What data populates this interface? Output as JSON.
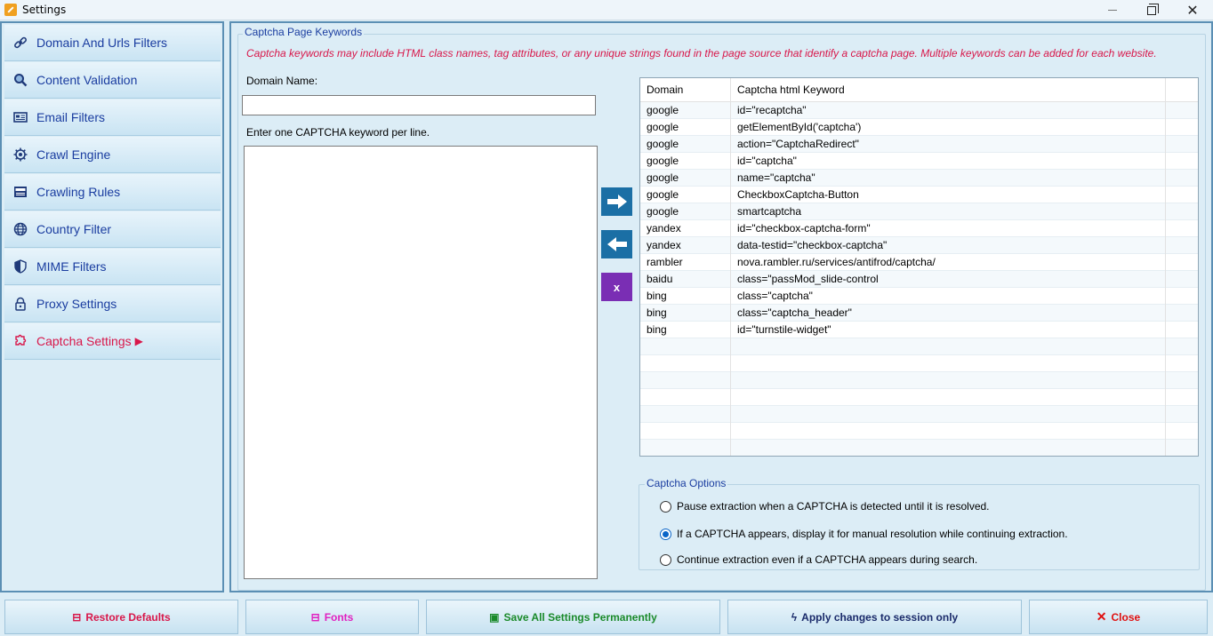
{
  "window": {
    "title": "Settings"
  },
  "sidebar": {
    "items": [
      {
        "label": "Domain And Urls Filters",
        "icon": "link-icon"
      },
      {
        "label": "Content Validation",
        "icon": "search-icon"
      },
      {
        "label": "Email Filters",
        "icon": "email-icon"
      },
      {
        "label": "Crawl Engine",
        "icon": "gear-icon"
      },
      {
        "label": "Crawling Rules",
        "icon": "rules-icon"
      },
      {
        "label": "Country Filter",
        "icon": "globe-icon"
      },
      {
        "label": "MIME Filters",
        "icon": "shield-icon"
      },
      {
        "label": "Proxy Settings",
        "icon": "lock-icon"
      },
      {
        "label": "Captcha Settings",
        "icon": "puzzle-icon",
        "active": true
      }
    ]
  },
  "captcha": {
    "group_title": "Captcha Page Keywords",
    "info": "Captcha keywords may include HTML class names, tag attributes, or any unique strings found in the page source that identify a captcha page. Multiple keywords can be added for each website.",
    "domain_label": "Domain Name:",
    "domain_value": "",
    "keywords_label": "Enter one CAPTCHA keyword per line.",
    "keywords_value": "",
    "remove_label": "x"
  },
  "grid": {
    "columns": [
      "Domain",
      "Captcha html Keyword",
      ""
    ],
    "rows": [
      [
        "google",
        "id=\"recaptcha\""
      ],
      [
        "google",
        "getElementById('captcha')"
      ],
      [
        "google",
        "action=\"CaptchaRedirect\""
      ],
      [
        "google",
        "id=\"captcha\""
      ],
      [
        "google",
        "name=\"captcha\""
      ],
      [
        "google",
        "CheckboxCaptcha-Button"
      ],
      [
        "google",
        "smartcaptcha"
      ],
      [
        "yandex",
        "id=\"checkbox-captcha-form\""
      ],
      [
        "yandex",
        "data-testid=\"checkbox-captcha\""
      ],
      [
        "rambler",
        "nova.rambler.ru/services/antifrod/captcha/"
      ],
      [
        "baidu",
        "class=\"passMod_slide-control"
      ],
      [
        "bing",
        "class=\"captcha\""
      ],
      [
        "bing",
        "class=\"captcha_header\""
      ],
      [
        "bing",
        "id=\"turnstile-widget\""
      ]
    ],
    "empty_rows": 7
  },
  "options": {
    "title": "Captcha Options",
    "items": [
      {
        "label": "Pause extraction when a CAPTCHA is detected until it is resolved.",
        "selected": false
      },
      {
        "label": "If a CAPTCHA appears, display it for manual resolution while continuing extraction.",
        "selected": true
      },
      {
        "label": "Continue extraction even if a CAPTCHA appears during search.",
        "selected": false
      }
    ]
  },
  "footer": {
    "restore": {
      "label": "Restore Defaults",
      "color": "#d8174a"
    },
    "fonts": {
      "label": "Fonts",
      "color": "#e020c0"
    },
    "save": {
      "label": "Save All Settings Permanently",
      "color": "#1a8a2a"
    },
    "apply": {
      "label": "Apply changes to session only",
      "color": "#1a2a6a"
    },
    "close": {
      "label": "Close",
      "color": "#e01010"
    }
  }
}
